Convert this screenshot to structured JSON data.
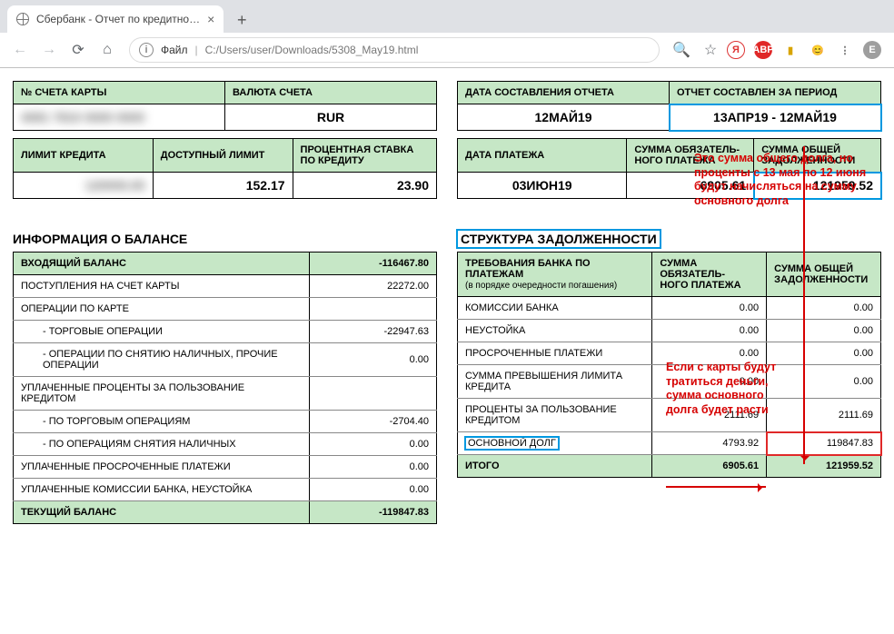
{
  "browser": {
    "tab_title": "Сбербанк - Отчет по кредитно…",
    "addr_label": "Файл",
    "addr_path": "C:/Users/user/Downloads/5308_May19.html",
    "avatar_letter": "E"
  },
  "top_left": {
    "card_account_label": "№ СЧЕТА КАРТЫ",
    "card_account_value": "",
    "currency_label": "ВАЛЮТА СЧЕТА",
    "currency_value": "RUR"
  },
  "top_right": {
    "report_date_label": "ДАТА СОСТАВЛЕНИЯ ОТЧЕТА",
    "report_date_value": "12МАЙ19",
    "period_label": "ОТЧЕТ СОСТАВЛЕН ЗА ПЕРИОД",
    "period_value": "13АПР19 - 12МАЙ19"
  },
  "limits_left": {
    "limit_label": "ЛИМИТ КРЕДИТА",
    "limit_value": "",
    "avail_label": "ДОСТУПНЫЙ ЛИМИТ",
    "avail_value": "152.17",
    "rate_label": "ПРОЦЕНТНАЯ СТАВКА ПО КРЕДИТУ",
    "rate_value": "23.90"
  },
  "limits_right": {
    "paydate_label": "ДАТА ПЛАТЕЖА",
    "paydate_value": "03ИЮН19",
    "mandatory_label": "СУММА ОБЯЗАТЕЛЬ-\nНОГО ПЛАТЕЖА",
    "mandatory_value": "6905.61",
    "total_debt_label": "СУММА ОБЩЕЙ ЗАДОЛЖЕННОСТИ",
    "total_debt_value": "121959.52"
  },
  "balance": {
    "heading": "ИНФОРМАЦИЯ О БАЛАНСЕ",
    "incoming_label": "ВХОДЯЩИЙ БАЛАНС",
    "incoming_value": "-116467.80",
    "rows": [
      {
        "label": "ПОСТУПЛЕНИЯ НА СЧЕТ КАРТЫ",
        "value": "22272.00"
      },
      {
        "label": "ОПЕРАЦИИ ПО КАРТЕ",
        "value": ""
      },
      {
        "label": "- ТОРГОВЫЕ ОПЕРАЦИИ",
        "value": "-22947.63",
        "indent": true
      },
      {
        "label": "- ОПЕРАЦИИ ПО СНЯТИЮ НАЛИЧНЫХ, ПРОЧИЕ ОПЕРАЦИИ",
        "value": "0.00",
        "indent": true
      },
      {
        "label": "УПЛАЧЕННЫЕ ПРОЦЕНТЫ ЗА ПОЛЬЗОВАНИЕ КРЕДИТОМ",
        "value": ""
      },
      {
        "label": "- ПО ТОРГОВЫМ ОПЕРАЦИЯМ",
        "value": "-2704.40",
        "indent": true
      },
      {
        "label": "- ПО ОПЕРАЦИЯМ СНЯТИЯ НАЛИЧНЫХ",
        "value": "0.00",
        "indent": true
      },
      {
        "label": "УПЛАЧЕННЫЕ ПРОСРОЧЕННЫЕ ПЛАТЕЖИ",
        "value": "0.00"
      },
      {
        "label": "УПЛАЧЕННЫЕ КОМИССИИ БАНКА, НЕУСТОЙКА",
        "value": "0.00"
      }
    ],
    "footer_label": "ТЕКУЩИЙ БАЛАНС",
    "footer_value": "-119847.83"
  },
  "debt": {
    "heading": "СТРУКТУРА ЗАДОЛЖЕННОСТИ",
    "col1_label": "ТРЕБОВАНИЯ БАНКА ПО ПЛАТЕЖАМ",
    "col1_sub": "(в порядке очередности погашения)",
    "col2_label": "СУММА ОБЯЗАТЕЛЬ-\nНОГО ПЛАТЕЖА",
    "col3_label": "СУММА ОБЩЕЙ ЗАДОЛЖЕННОСТИ",
    "rows": [
      {
        "label": "КОМИССИИ БАНКА",
        "v1": "0.00",
        "v2": "0.00"
      },
      {
        "label": "НЕУСТОЙКА",
        "v1": "0.00",
        "v2": "0.00"
      },
      {
        "label": "ПРОСРОЧЕННЫЕ ПЛАТЕЖИ",
        "v1": "0.00",
        "v2": "0.00"
      },
      {
        "label": "СУММА ПРЕВЫШЕНИЯ ЛИМИТА КРЕДИТА",
        "v1": "0.00",
        "v2": "0.00"
      },
      {
        "label": "ПРОЦЕНТЫ ЗА ПОЛЬЗОВАНИЕ КРЕДИТОМ",
        "v1": "2111.69",
        "v2": "2111.69"
      },
      {
        "label": "ОСНОВНОЙ ДОЛГ",
        "v1": "4793.92",
        "v2": "119847.83"
      }
    ],
    "footer_label": "ИТОГО",
    "footer_v1": "6905.61",
    "footer_v2": "121959.52"
  },
  "annotations": {
    "note1": "Это сумма общего долга, но проценты с 13 мая по 12 июня будут начисляться на сумму основного долга",
    "note2": "Если с карты будут тратиться деньги, сумма основного долга будет расти"
  }
}
